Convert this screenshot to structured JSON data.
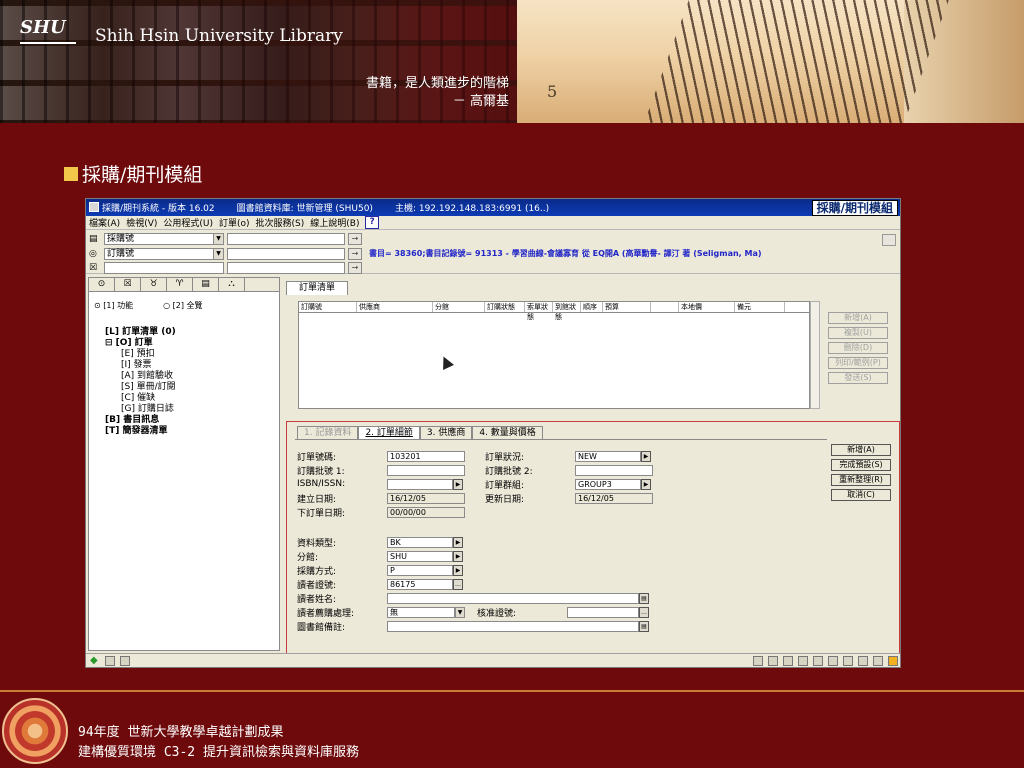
{
  "banner": {
    "logo_text": "SHU",
    "library_title": "Shih Hsin University Library",
    "motto_line1": "書籍，是人類進步的階梯",
    "motto_line2": "－ 高爾基",
    "stair_number": "5"
  },
  "slide": {
    "heading": "採購/期刊模組"
  },
  "app": {
    "title_segments": [
      "採購/期刊系統 - 版本 16.02",
      "圖書館資料庫: 世新管理 (SHU50)",
      "主機: 192.192.148.183:6991 (16..)"
    ],
    "module_badge": "採購/期刊模組",
    "menu": [
      "檔案(A)",
      "檢視(V)",
      "公用程式(U)",
      "訂單(o)",
      "批次服務(S)",
      "線上說明(B)"
    ],
    "help_button": "?",
    "toolbar": {
      "combo1": "採購號",
      "combo2": "訂購號",
      "go": "→"
    },
    "info_line": "書目= 38360;書目記錄號= 91313 - 學習曲線-會議寡育 從 EQ開A (高華勳譽- 譯汀 著 (Seligman, Ma)",
    "left_tabs": [
      "⊙",
      "☒",
      "♉",
      "♈",
      "▤",
      "⛬"
    ],
    "radio1": "⊙ [1] 功能",
    "radio2": "○ [2] 全覽",
    "tree": [
      {
        "label": "[L] 訂單清單 (0)",
        "level": 1,
        "bold": true
      },
      {
        "label": "⊟ [O] 訂單",
        "level": 1,
        "bold": true
      },
      {
        "label": "[E] 預扣",
        "level": 2,
        "bold": false
      },
      {
        "label": "[I] 發票",
        "level": 2,
        "bold": false
      },
      {
        "label": "[A] 到館驗收",
        "level": 2,
        "bold": false
      },
      {
        "label": "[S] 單冊/訂閱",
        "level": 2,
        "bold": false
      },
      {
        "label": "[C] 催缺",
        "level": 2,
        "bold": false
      },
      {
        "label": "[G] 訂購日誌",
        "level": 2,
        "bold": false
      },
      {
        "label": "[B] 書目訊息",
        "level": 1,
        "bold": true
      },
      {
        "label": "[T] 簡發器清單",
        "level": 1,
        "bold": true
      }
    ],
    "list_tab": "訂單清單",
    "list_columns": [
      "訂購號",
      "供應商",
      "分館",
      "訂購狀態",
      "索單狀態",
      "到館狀態",
      "順序",
      "預算",
      "",
      "本地價",
      "備元"
    ],
    "list_buttons": [
      "新增(A)",
      "複製(U)",
      "刪除(D)",
      "列印/範例(P)",
      "發送(S)"
    ],
    "form_tabs": [
      "1. 記錄資料",
      "2. 訂單細節",
      "3. 供應商",
      "4. 數量與價格"
    ],
    "form": {
      "order_no_label": "訂單號碼:",
      "order_no": "103201",
      "batch1_label": "訂購批號 1:",
      "batch1": "",
      "isbn_label": "ISBN/ISSN:",
      "isbn": "",
      "created_label": "建立日期:",
      "created": "16/12/05",
      "placed_label": "下訂單日期:",
      "placed": "00/00/00",
      "status_label": "訂單狀況:",
      "status": "NEW",
      "batch2_label": "訂購批號 2:",
      "batch2": "",
      "group_label": "訂單群組:",
      "group": "GROUP3",
      "updated_label": "更新日期:",
      "updated": "16/12/05",
      "material_label": "資料類型:",
      "material": "BK",
      "branch_label": "分館:",
      "branch": "SHU",
      "method_label": "採購方式:",
      "method": "P",
      "patron_label": "讀者證號:",
      "patron": "86175",
      "patron_name_label": "讀者姓名:",
      "patron_name": "",
      "handling_label": "讀者薦購處理:",
      "handling": "無",
      "approve_label": "核准證號:",
      "approve": "",
      "note_label": "圖書館備註:",
      "note": ""
    },
    "form_buttons": [
      "新增(A)",
      "完成預設(S)",
      "重新整理(R)",
      "取消(C)"
    ]
  },
  "footer": {
    "line1": "94年度 世新大學教學卓越計劃成果",
    "line2": "建構優質環境 C3-2 提升資訊檢索與資料庫服務"
  },
  "colors": {
    "background": "#6e0a0c",
    "title_bar": "#0d3bb5",
    "bullet": "#f2c84b"
  }
}
